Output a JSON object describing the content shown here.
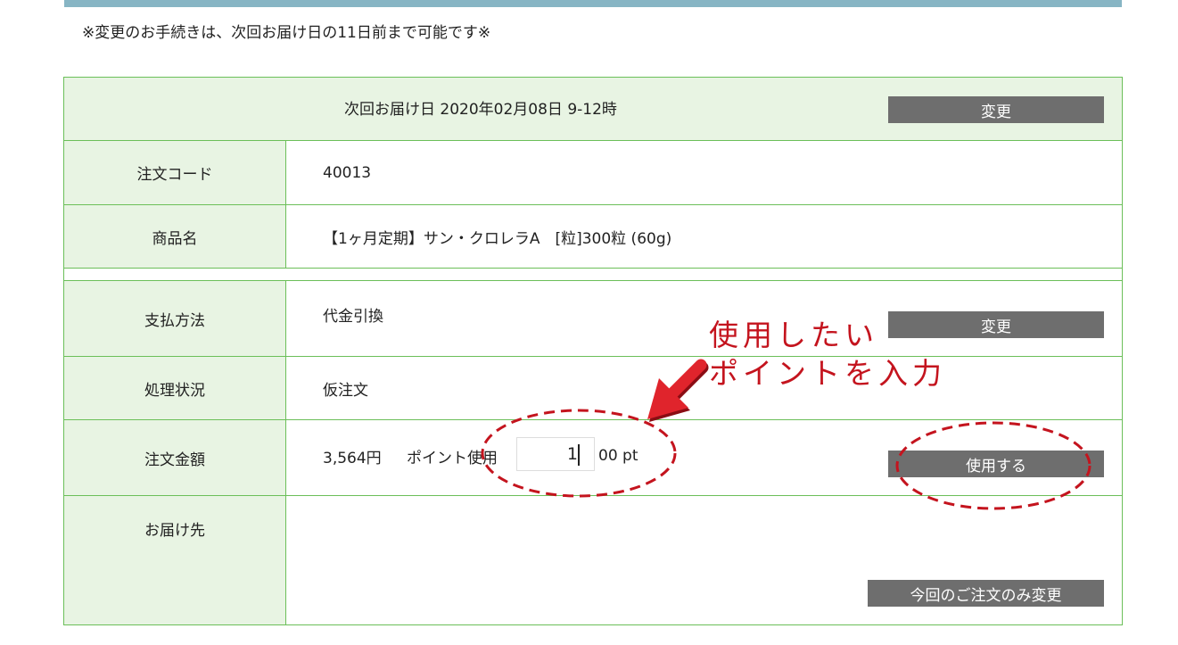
{
  "notice": "※変更のお手続きは、次回お届け日の11日前まで可能です※",
  "delivery": {
    "text": "次回お届け日 2020年02月08日 9-12時",
    "change_label": "変更"
  },
  "order_code": {
    "label": "注文コード",
    "value": "40013"
  },
  "product": {
    "label": "商品名",
    "value": "【1ヶ月定期】サン・クロレラA　[粒]300粒 (60g)"
  },
  "payment": {
    "label": "支払方法",
    "value": "代金引換",
    "change_label": "変更"
  },
  "status": {
    "label": "処理状況",
    "value": "仮注文"
  },
  "amount": {
    "label": "注文金額",
    "value": "3,564円",
    "point_label": "ポイント使用",
    "point_input_value": "1",
    "point_suffix": "00 pt",
    "use_label": "使用する"
  },
  "shipping": {
    "label": "お届け先",
    "change_once_label": "今回のご注文のみ変更"
  },
  "annotation": {
    "line1": "使用したい",
    "line2": "ポイントを入力"
  },
  "colors": {
    "border": "#6bbf59",
    "label_bg": "#e8f4e3",
    "button_bg": "#6e6e6e",
    "topbar": "#87b5c4",
    "annotation_red": "#c4141e"
  }
}
